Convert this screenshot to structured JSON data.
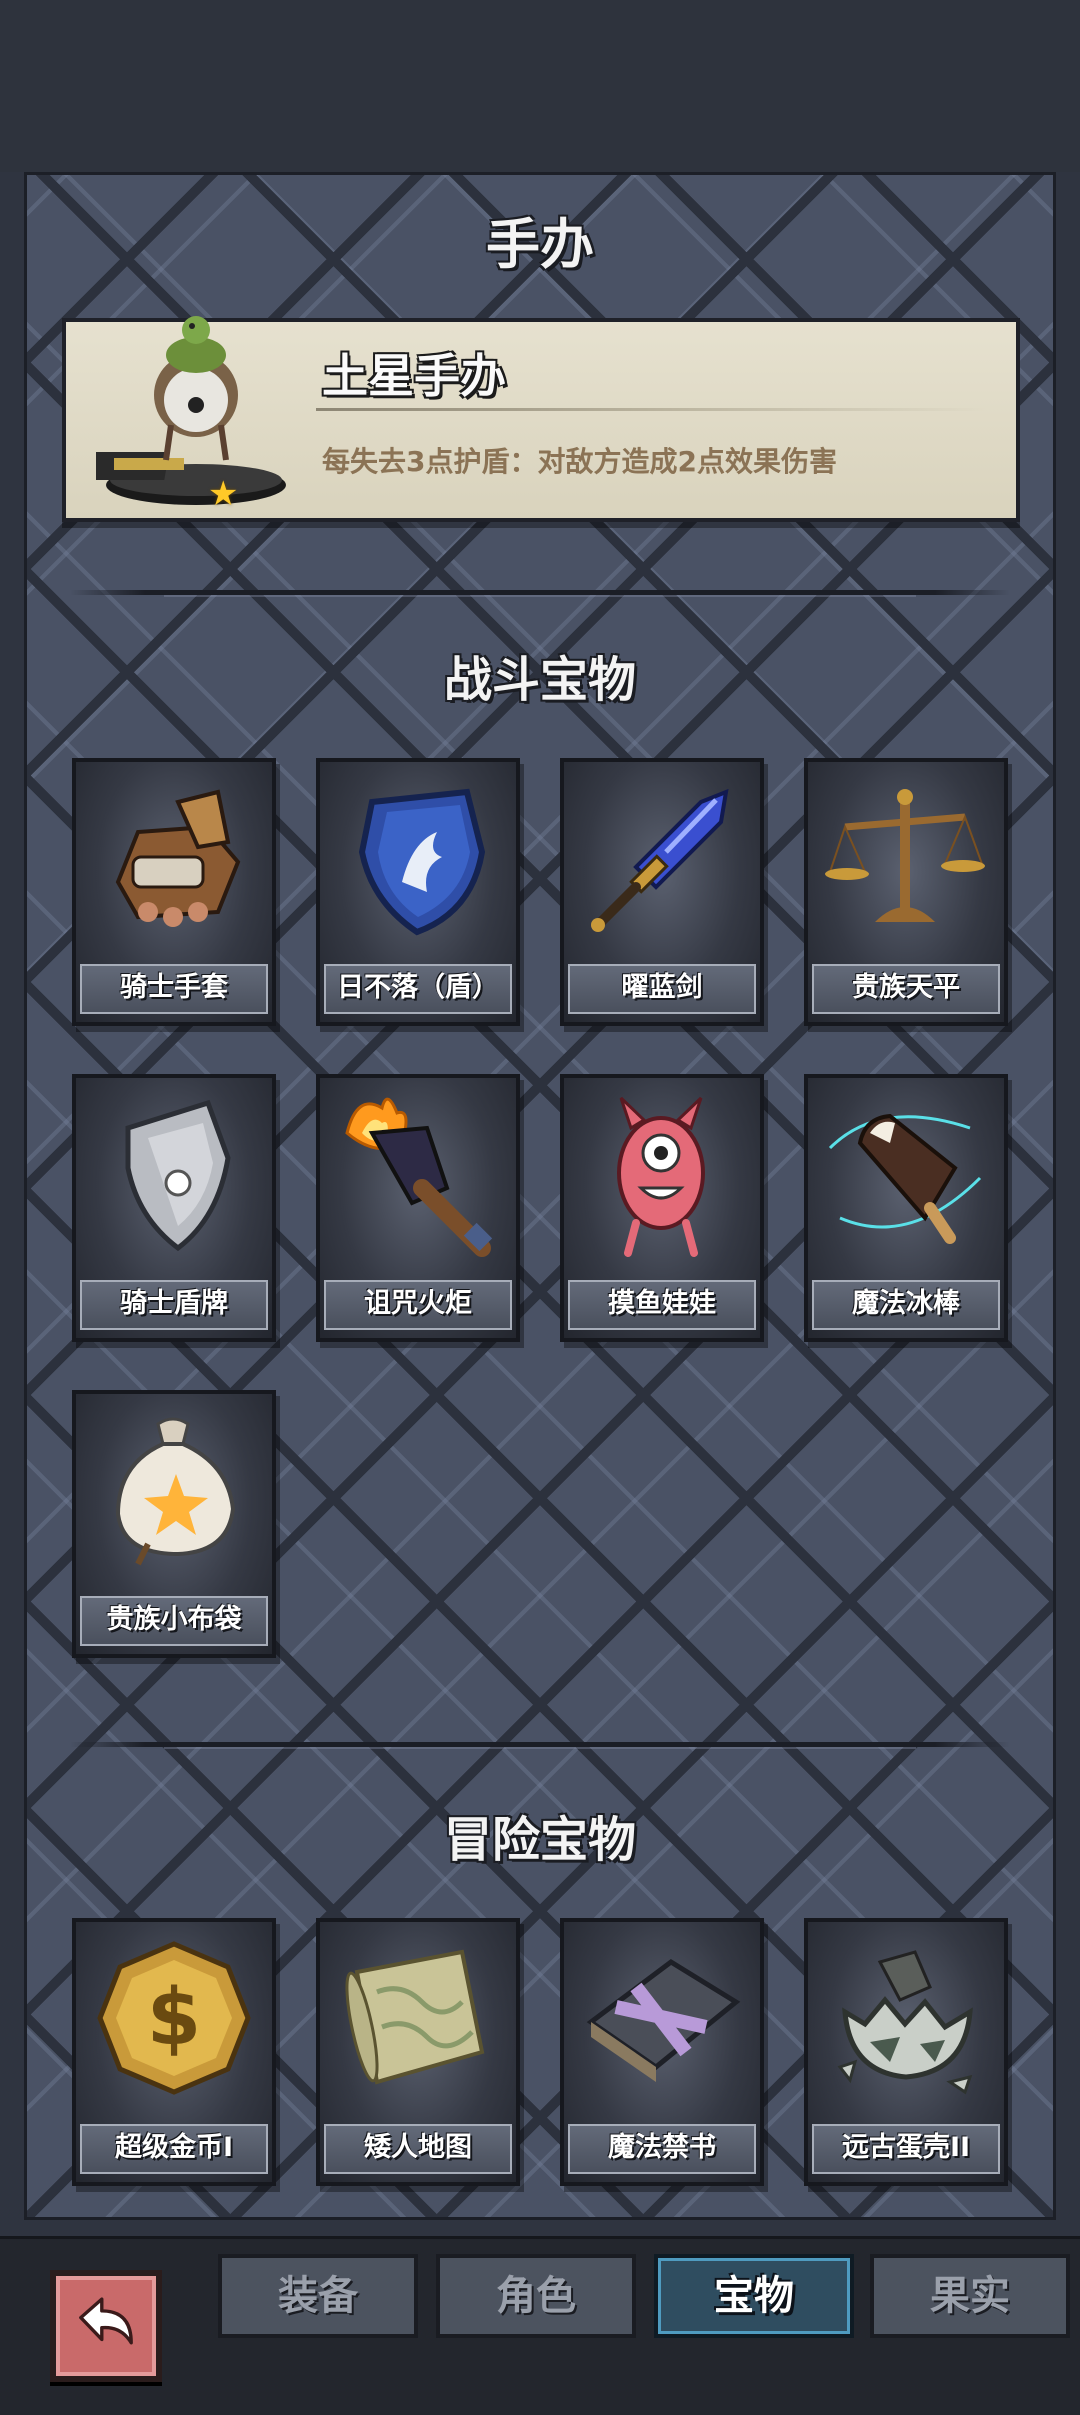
{
  "figure_section": {
    "title": "手办",
    "figure": {
      "name": "土星手办",
      "description": "每失去3点护盾：对敌方造成2点效果伤害",
      "rarity_stars": 1,
      "star_glyph": "★"
    }
  },
  "battle_section": {
    "title": "战斗宝物",
    "items": [
      {
        "label": "骑士手套",
        "icon": "knight-gauntlet-icon"
      },
      {
        "label": "日不落（盾）",
        "icon": "blue-shield-icon"
      },
      {
        "label": "曜蓝剑",
        "icon": "blue-sword-icon"
      },
      {
        "label": "贵族天平",
        "icon": "scales-icon"
      },
      {
        "label": "骑士盾牌",
        "icon": "knight-shield-icon"
      },
      {
        "label": "诅咒火炬",
        "icon": "cursed-torch-icon"
      },
      {
        "label": "摸鱼娃娃",
        "icon": "pink-doll-icon"
      },
      {
        "label": "魔法冰棒",
        "icon": "magic-popsicle-icon"
      },
      {
        "label": "贵族小布袋",
        "icon": "cloth-bag-icon"
      }
    ]
  },
  "adventure_section": {
    "title": "冒险宝物",
    "items": [
      {
        "label": "超级金币I",
        "icon": "gold-coin-icon"
      },
      {
        "label": "矮人地图",
        "icon": "map-scroll-icon"
      },
      {
        "label": "魔法禁书",
        "icon": "forbidden-book-icon"
      },
      {
        "label": "远古蛋壳II",
        "icon": "ancient-eggshell-icon"
      }
    ]
  },
  "nav": {
    "back_icon": "back-arrow-icon",
    "tabs": [
      {
        "label": "装备",
        "active": false
      },
      {
        "label": "角色",
        "active": false
      },
      {
        "label": "宝物",
        "active": true
      },
      {
        "label": "果实",
        "active": false
      }
    ]
  },
  "colors": {
    "panel": "#4a5265",
    "card": "#e6e1cf",
    "active_tab": "#2f4d60",
    "back_button": "#c96a6a",
    "star": "#ffc928"
  }
}
